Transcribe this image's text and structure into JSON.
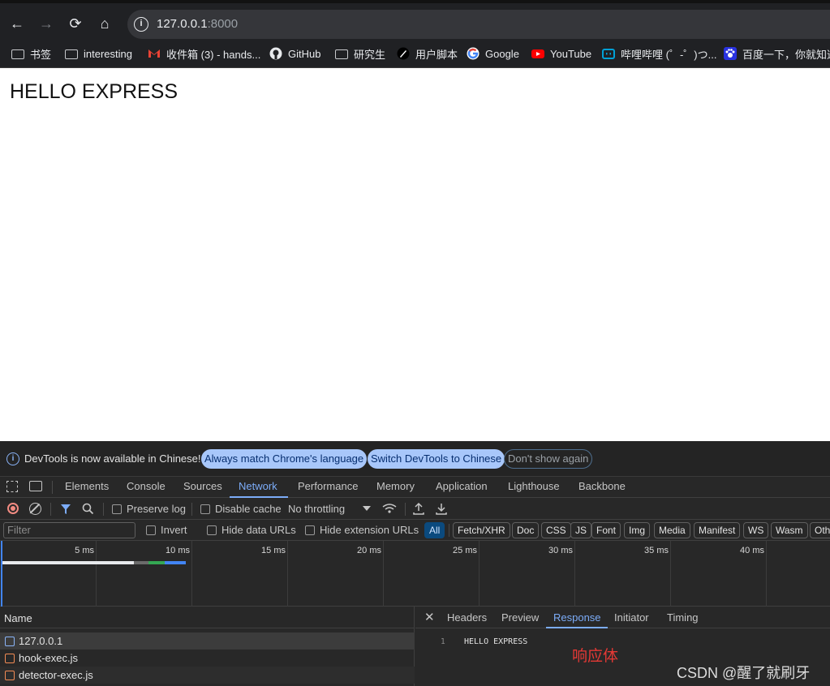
{
  "browser": {
    "url_host": "127.0.0.1",
    "url_port": ":8000",
    "nav": {
      "back": "←",
      "forward": "→",
      "reload": "⟳",
      "home": "⌂"
    }
  },
  "bookmarks": [
    {
      "label": "书签",
      "icon": "folder-icon"
    },
    {
      "label": "interesting",
      "icon": "folder-icon"
    },
    {
      "label": "收件箱 (3) - hands...",
      "icon": "gmail-icon"
    },
    {
      "label": "GitHub",
      "icon": "github-icon"
    },
    {
      "label": "研究生",
      "icon": "folder-icon"
    },
    {
      "label": "用户脚本",
      "icon": "userscript-icon"
    },
    {
      "label": "Google",
      "icon": "google-icon"
    },
    {
      "label": "YouTube",
      "icon": "youtube-icon"
    },
    {
      "label": "哔哩哔哩 (゜-゜)つ...",
      "icon": "bilibili-icon"
    },
    {
      "label": "百度一下，你就知道",
      "icon": "baidu-icon"
    }
  ],
  "page": {
    "heading": "HELLO EXPRESS"
  },
  "devtools": {
    "notice": {
      "message": "DevTools is now available in Chinese!",
      "btn_match": "Always match Chrome's language",
      "btn_switch": "Switch DevTools to Chinese",
      "btn_dismiss": "Don't show again"
    },
    "tabs": [
      "Elements",
      "Console",
      "Sources",
      "Network",
      "Performance",
      "Memory",
      "Application",
      "Lighthouse",
      "Backbone"
    ],
    "active_tab": "Network",
    "toolbar": {
      "preserve_log": "Preserve log",
      "disable_cache": "Disable cache",
      "throttling": "No throttling"
    },
    "filter": {
      "placeholder": "Filter",
      "invert": "Invert",
      "hide_data_urls": "Hide data URLs",
      "hide_extension_urls": "Hide extension URLs",
      "types": [
        "All",
        "Fetch/XHR",
        "Doc",
        "CSS",
        "JS",
        "Font",
        "Img",
        "Media",
        "Manifest",
        "WS",
        "Wasm",
        "Oth"
      ]
    },
    "timeline_ticks": [
      "5 ms",
      "10 ms",
      "15 ms",
      "20 ms",
      "25 ms",
      "30 ms",
      "35 ms",
      "40 ms"
    ],
    "requests": {
      "header": "Name",
      "items": [
        {
          "name": "127.0.0.1",
          "icon": "document-icon"
        },
        {
          "name": "hook-exec.js",
          "icon": "script-icon"
        },
        {
          "name": "detector-exec.js",
          "icon": "script-icon"
        }
      ]
    },
    "detail": {
      "close": "✕",
      "tabs": [
        "Headers",
        "Preview",
        "Response",
        "Initiator",
        "Timing"
      ],
      "active_tab": "Response",
      "line_no": "1",
      "response_text": "HELLO EXPRESS",
      "annotation": "响应体"
    }
  },
  "watermark": "CSDN @醒了就刷牙",
  "colors": {
    "accent": "#7cacf8",
    "annotation": "#e53935",
    "chrome_bg": "#202124",
    "devtools_bg": "#282828"
  }
}
